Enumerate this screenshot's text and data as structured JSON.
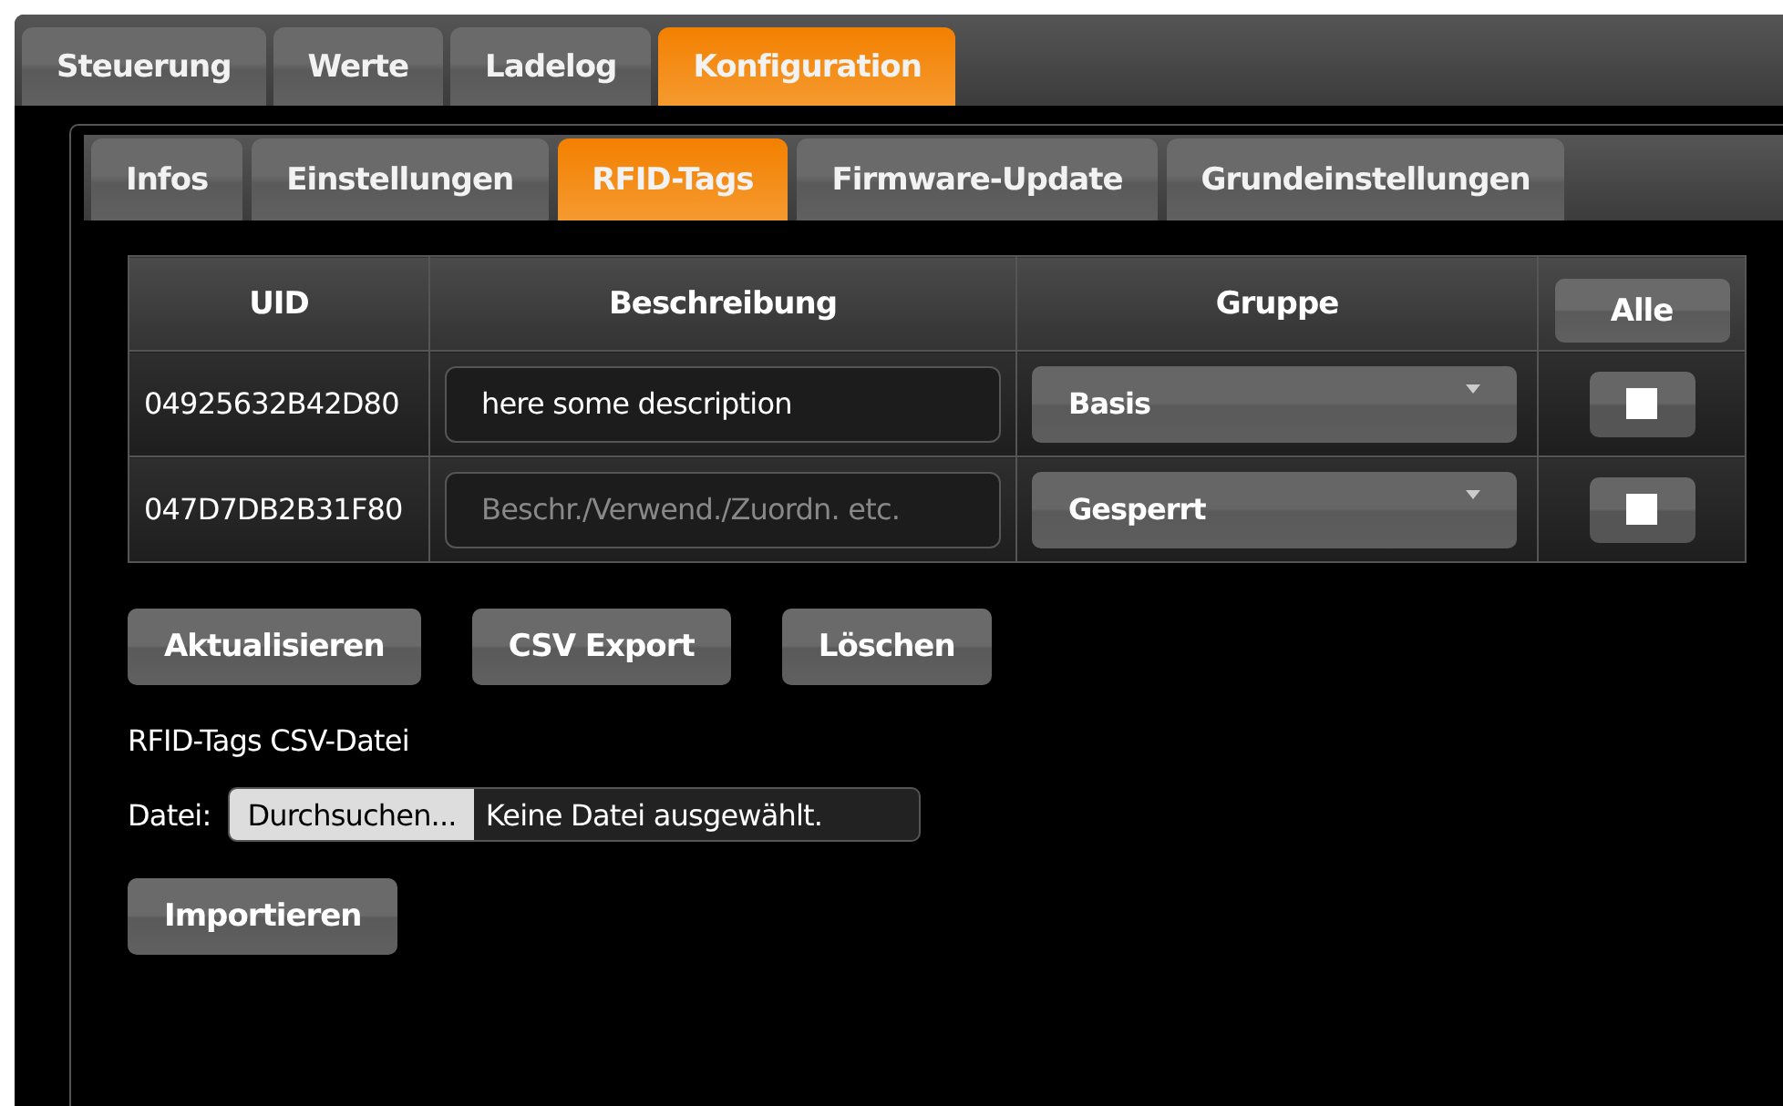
{
  "main_tabs": [
    {
      "label": "Steuerung",
      "selected": false
    },
    {
      "label": "Werte",
      "selected": false
    },
    {
      "label": "Ladelog",
      "selected": false
    },
    {
      "label": "Konfiguration",
      "selected": true
    }
  ],
  "sub_tabs": [
    {
      "label": "Infos",
      "selected": false
    },
    {
      "label": "Einstellungen",
      "selected": false
    },
    {
      "label": "RFID-Tags",
      "selected": true
    },
    {
      "label": "Firmware-Update",
      "selected": false
    },
    {
      "label": "Grundeinstellungen",
      "selected": false
    }
  ],
  "table": {
    "columns": [
      "UID",
      "Beschreibung",
      "Gruppe"
    ],
    "all_button": "Alle",
    "rows": [
      {
        "uid": "04925632B42D80",
        "description": "here some description",
        "group": "Basis",
        "checked": false
      },
      {
        "uid": "047D7DB2B31F80",
        "placeholder": "Beschr./Verwend./Zuordn. etc.",
        "group": "Gesperrt",
        "checked": false
      }
    ]
  },
  "actions": [
    "Aktualisieren",
    "CSV Export",
    "Löschen"
  ],
  "csv_section": {
    "title": "RFID-Tags CSV-Datei",
    "file_label": "Datei:",
    "browse_button": "Durchsuchen...",
    "file_status": "Keine Datei ausgewählt.",
    "import_button": "Importieren"
  }
}
